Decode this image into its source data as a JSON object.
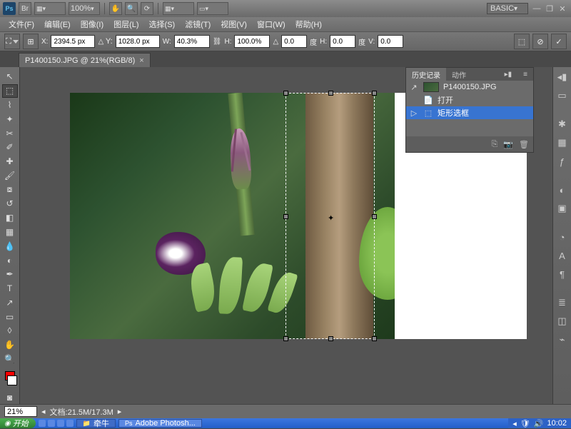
{
  "titlebar": {
    "zoom_dropdown": "100%",
    "workspace": "BASIC"
  },
  "menu": {
    "file": "文件(F)",
    "edit": "编辑(E)",
    "image": "图像(I)",
    "layer": "图层(L)",
    "select": "选择(S)",
    "filter": "滤镜(T)",
    "view": "视图(V)",
    "window": "窗口(W)",
    "help": "帮助(H)"
  },
  "options": {
    "x_label": "X:",
    "x_value": "2394.5 px",
    "y_label": "Y:",
    "y_value": "1028.0 px",
    "w_label": "W:",
    "w_value": "40.3%",
    "h_label": "H:",
    "h_value": "100.0%",
    "angle_label": "度",
    "angle_value": "0.0",
    "hskew_label": "H:",
    "hskew_value": "0.0",
    "vskew_label": "V:",
    "vskew_value": "0.0",
    "deg2": "度"
  },
  "tab": {
    "title": "P1400150.JPG @ 21%(RGB/8)"
  },
  "history": {
    "tab1": "历史记录",
    "tab2": "动作",
    "filename": "P1400150.JPG",
    "step1": "打开",
    "step2": "矩形选框"
  },
  "status": {
    "zoom": "21%",
    "doc": "文档:21.5M/17.3M"
  },
  "taskbar": {
    "start": "开始",
    "app1": "牵牛",
    "app2": "Adobe Photosh...",
    "time": "10:02"
  }
}
